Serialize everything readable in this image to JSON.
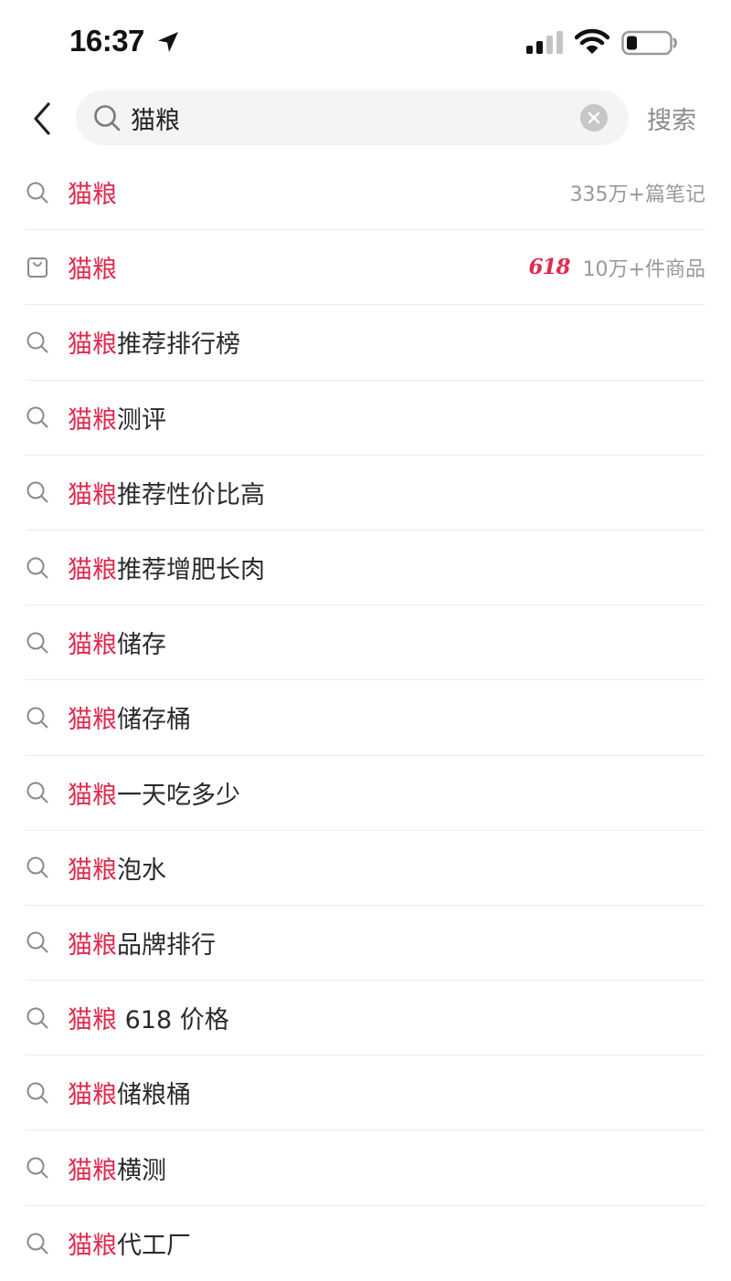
{
  "status_bar": {
    "time": "16:37"
  },
  "search": {
    "query": "猫粮",
    "action_label": "搜索"
  },
  "colors": {
    "highlight": "#e02a4f",
    "muted": "#999999"
  },
  "suggestions": [
    {
      "icon": "search-icon",
      "highlight": "猫粮",
      "rest": "",
      "meta": "335万+篇笔记",
      "badge": ""
    },
    {
      "icon": "shopping-bag-icon",
      "highlight": "猫粮",
      "rest": "",
      "meta": "10万+件商品",
      "badge": "618"
    },
    {
      "icon": "search-icon",
      "highlight": "猫粮",
      "rest": "推荐排行榜",
      "meta": "",
      "badge": ""
    },
    {
      "icon": "search-icon",
      "highlight": "猫粮",
      "rest": "测评",
      "meta": "",
      "badge": ""
    },
    {
      "icon": "search-icon",
      "highlight": "猫粮",
      "rest": "推荐性价比高",
      "meta": "",
      "badge": ""
    },
    {
      "icon": "search-icon",
      "highlight": "猫粮",
      "rest": "推荐增肥长肉",
      "meta": "",
      "badge": ""
    },
    {
      "icon": "search-icon",
      "highlight": "猫粮",
      "rest": "储存",
      "meta": "",
      "badge": ""
    },
    {
      "icon": "search-icon",
      "highlight": "猫粮",
      "rest": "储存桶",
      "meta": "",
      "badge": ""
    },
    {
      "icon": "search-icon",
      "highlight": "猫粮",
      "rest": "一天吃多少",
      "meta": "",
      "badge": ""
    },
    {
      "icon": "search-icon",
      "highlight": "猫粮",
      "rest": "泡水",
      "meta": "",
      "badge": ""
    },
    {
      "icon": "search-icon",
      "highlight": "猫粮",
      "rest": "品牌排行",
      "meta": "",
      "badge": ""
    },
    {
      "icon": "search-icon",
      "highlight": "猫粮",
      "rest": " 618 价格",
      "meta": "",
      "badge": ""
    },
    {
      "icon": "search-icon",
      "highlight": "猫粮",
      "rest": "储粮桶",
      "meta": "",
      "badge": ""
    },
    {
      "icon": "search-icon",
      "highlight": "猫粮",
      "rest": "横测",
      "meta": "",
      "badge": ""
    },
    {
      "icon": "search-icon",
      "highlight": "猫粮",
      "rest": "代工厂",
      "meta": "",
      "badge": ""
    }
  ]
}
